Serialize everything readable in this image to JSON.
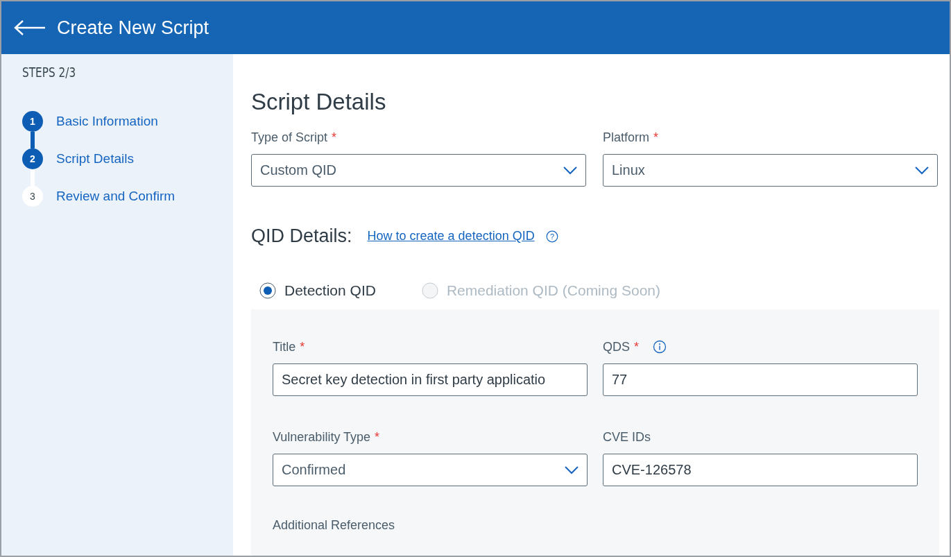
{
  "header": {
    "title": "Create New Script"
  },
  "sidebar": {
    "steps_label": "STEPS 2/3",
    "steps": [
      {
        "number": "1",
        "label": "Basic Information",
        "reached": true
      },
      {
        "number": "2",
        "label": "Script Details",
        "reached": true
      },
      {
        "number": "3",
        "label": "Review and Confirm",
        "reached": false
      }
    ]
  },
  "main": {
    "heading": "Script Details",
    "top_fields": [
      {
        "label": "Type of Script",
        "required_mark": "*",
        "value": "Custom QID",
        "kind": "dropdown"
      },
      {
        "label": "Platform",
        "required_mark": "*",
        "value": "Linux",
        "kind": "dropdown"
      }
    ],
    "qid_heading": "QID Details:",
    "qid_link": "How to create a detection QID",
    "help_icon": "?",
    "qid_types": [
      {
        "label": "Detection QID",
        "selected": true,
        "disabled": false
      },
      {
        "label": "Remediation QID (Coming Soon)",
        "selected": false,
        "disabled": true
      }
    ],
    "qid_fields": [
      {
        "label": "Title",
        "required_mark": "*",
        "value": "Secret key detection in first party applicatio",
        "kind": "text",
        "info": false
      },
      {
        "label": "QDS",
        "required_mark": "*",
        "value": "77",
        "kind": "text",
        "info": true
      },
      {
        "label": "Vulnerability Type",
        "required_mark": "*",
        "value": "Confirmed",
        "kind": "dropdown",
        "info": false
      },
      {
        "label": "CVE IDs",
        "value": "CVE-126578",
        "kind": "text",
        "info": false
      }
    ],
    "next_label": "Additional References"
  }
}
